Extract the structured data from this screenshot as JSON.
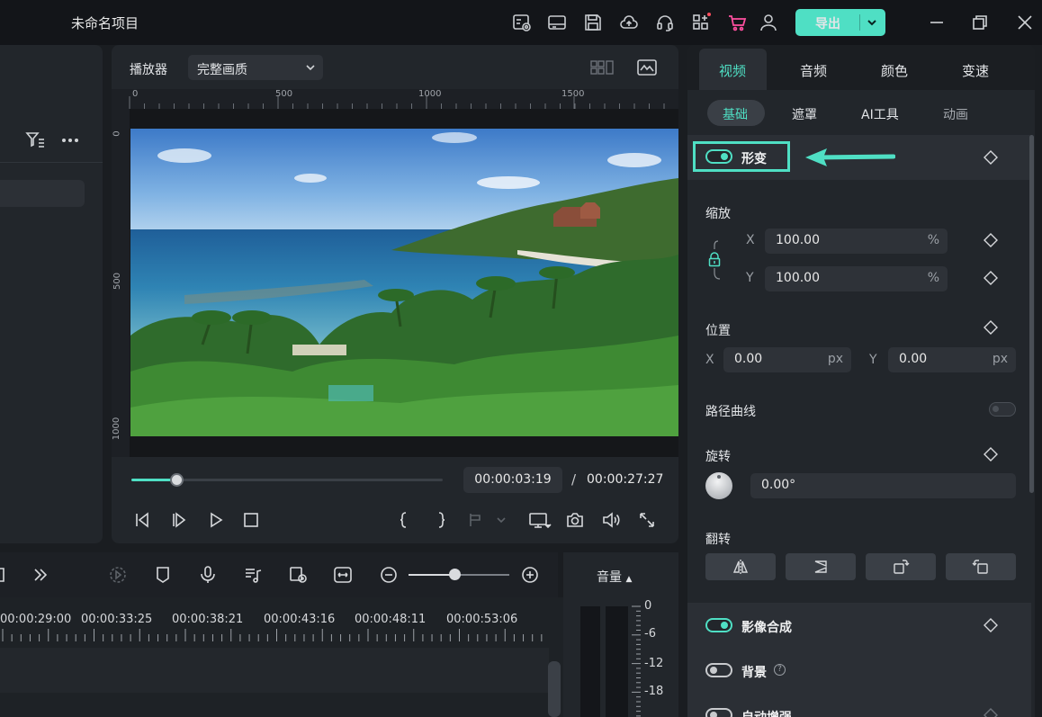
{
  "app": {
    "title": "未命名项目",
    "export_label": "导出",
    "accent": "#4fdfc4"
  },
  "titlebar_icons": [
    "project-settings-icon",
    "layout-icon",
    "save-icon",
    "cloud-upload-icon",
    "headset-icon",
    "apps-icon",
    "cart-icon",
    "user-icon",
    "minimize-icon",
    "restore-icon",
    "close-icon"
  ],
  "player": {
    "label": "播放器",
    "quality": "完整画质",
    "ruler_top": [
      "0",
      "500",
      "1000",
      "1500"
    ],
    "ruler_left": [
      "0",
      "500",
      "1000"
    ],
    "current_time": "00:00:03:19",
    "time_separator": "/",
    "total_time": "00:00:27:27",
    "progress_fraction": 0.144
  },
  "timeline": {
    "times": [
      "00:00:29:00",
      "00:00:33:25",
      "00:00:38:21",
      "00:00:43:16",
      "00:00:48:11",
      "00:00:53:06"
    ],
    "zoom_fraction": 0.46
  },
  "volume": {
    "title": "音量",
    "db_labels": [
      "0",
      "-6",
      "-12",
      "-18"
    ]
  },
  "inspector": {
    "tabs": [
      "视频",
      "音频",
      "颜色",
      "变速"
    ],
    "active_tab": "视频",
    "subtabs": [
      "基础",
      "遮罩",
      "AI工具",
      "动画"
    ],
    "active_subtab": "基础",
    "transform": {
      "title": "形变",
      "enabled": true,
      "scale": {
        "label": "缩放",
        "x_axis": "X",
        "y_axis": "Y",
        "x_value": "100.00",
        "y_value": "100.00",
        "unit": "%"
      },
      "position": {
        "label": "位置",
        "x_axis": "X",
        "y_axis": "Y",
        "x_value": "0.00",
        "y_value": "0.00",
        "unit": "px"
      },
      "path_curve": {
        "label": "路径曲线",
        "enabled": false
      },
      "rotation": {
        "label": "旋转",
        "value": "0.00°"
      },
      "flip": {
        "label": "翻转"
      }
    },
    "compositing": {
      "title": "影像合成",
      "enabled": true
    },
    "background": {
      "title": "背景",
      "enabled": false
    },
    "auto_enhance": {
      "title": "自动增强",
      "enabled": false
    }
  }
}
